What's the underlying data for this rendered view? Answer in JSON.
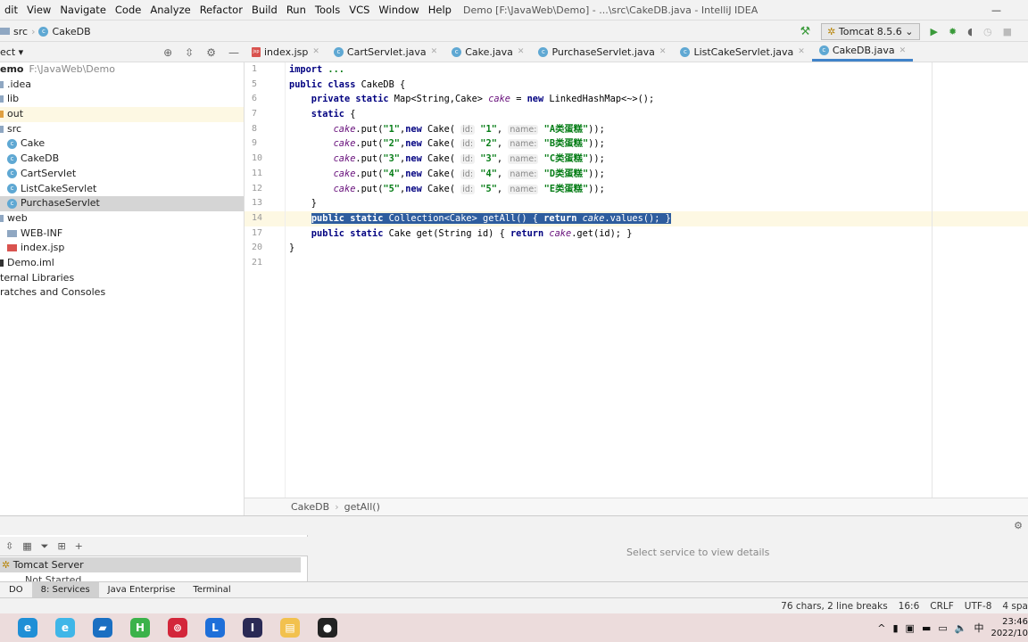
{
  "menu": [
    "dit",
    "View",
    "Navigate",
    "Code",
    "Analyze",
    "Refactor",
    "Build",
    "Run",
    "Tools",
    "VCS",
    "Window",
    "Help"
  ],
  "window_title": "Demo [F:\\JavaWeb\\Demo] - ...\\src\\CakeDB.java - IntelliJ IDEA",
  "breadcrumb": [
    "src",
    "CakeDB"
  ],
  "run_config": "Tomcat 8.5.6",
  "project_header": "ect ▾",
  "tabs": [
    {
      "label": "index.jsp",
      "icon": "jsp-icon"
    },
    {
      "label": "CartServlet.java",
      "icon": "class-icon"
    },
    {
      "label": "Cake.java",
      "icon": "class-icon"
    },
    {
      "label": "PurchaseServlet.java",
      "icon": "class-icon"
    },
    {
      "label": "ListCakeServlet.java",
      "icon": "class-icon"
    },
    {
      "label": "CakeDB.java",
      "icon": "class-icon",
      "active": true
    }
  ],
  "tree": [
    {
      "label": "emo",
      "extra": "F:\\JavaWeb\\Demo",
      "indent": 0,
      "bold": true
    },
    {
      "label": ".idea",
      "indent": 0,
      "icon": "folder-icon"
    },
    {
      "label": "lib",
      "indent": 0,
      "icon": "folder-icon"
    },
    {
      "label": "out",
      "indent": 0,
      "icon": "folder-icon",
      "highlight": true
    },
    {
      "label": "src",
      "indent": 0,
      "icon": "folder-icon"
    },
    {
      "label": "Cake",
      "indent": 1,
      "icon": "class-icon"
    },
    {
      "label": "CakeDB",
      "indent": 1,
      "icon": "class-icon"
    },
    {
      "label": "CartServlet",
      "indent": 1,
      "icon": "class-icon"
    },
    {
      "label": "ListCakeServlet",
      "indent": 1,
      "icon": "class-icon"
    },
    {
      "label": "PurchaseServlet",
      "indent": 1,
      "icon": "class-icon",
      "selected": true
    },
    {
      "label": "web",
      "indent": 0,
      "icon": "folder-icon"
    },
    {
      "label": "WEB-INF",
      "indent": 1,
      "icon": "folder-icon"
    },
    {
      "label": "index.jsp",
      "indent": 1,
      "icon": "jsp-icon"
    },
    {
      "label": "Demo.iml",
      "indent": 0,
      "icon": "file-icon"
    },
    {
      "label": "ternal Libraries",
      "indent": 0
    },
    {
      "label": "ratches and Consoles",
      "indent": 0
    }
  ],
  "line_numbers": [
    "1",
    "5",
    "6",
    "7",
    "8",
    "9",
    "10",
    "11",
    "12",
    "13",
    "14",
    "17",
    "20",
    "21"
  ],
  "code": [
    [
      {
        "t": "import ",
        "c": "kw"
      },
      {
        "t": "...",
        "c": "st"
      }
    ],
    [
      {
        "t": "public class ",
        "c": "kw"
      },
      {
        "t": "CakeDB {",
        "c": "pl"
      }
    ],
    [
      {
        "t": "    private static ",
        "c": "kw"
      },
      {
        "t": "Map<String,Cake> ",
        "c": "pl"
      },
      {
        "t": "cake",
        "c": "fd"
      },
      {
        "t": " = ",
        "c": "pl"
      },
      {
        "t": "new ",
        "c": "kw"
      },
      {
        "t": "LinkedHashMap<~>();",
        "c": "pl"
      }
    ],
    [
      {
        "t": "    static ",
        "c": "kw"
      },
      {
        "t": "{",
        "c": "pl"
      }
    ],
    [
      {
        "t": "        cake",
        "c": "fd"
      },
      {
        "t": ".put(",
        "c": "pl"
      },
      {
        "t": "\"1\"",
        "c": "st"
      },
      {
        "t": ",",
        "c": "pl"
      },
      {
        "t": "new ",
        "c": "kw"
      },
      {
        "t": "Cake( ",
        "c": "pl"
      },
      {
        "t": "id:",
        "c": "ht"
      },
      {
        "t": " \"1\"",
        "c": "st"
      },
      {
        "t": ", ",
        "c": "pl"
      },
      {
        "t": "name:",
        "c": "ht"
      },
      {
        "t": " \"A类蛋糕\"",
        "c": "st"
      },
      {
        "t": "));",
        "c": "pl"
      }
    ],
    [
      {
        "t": "        cake",
        "c": "fd"
      },
      {
        "t": ".put(",
        "c": "pl"
      },
      {
        "t": "\"2\"",
        "c": "st"
      },
      {
        "t": ",",
        "c": "pl"
      },
      {
        "t": "new ",
        "c": "kw"
      },
      {
        "t": "Cake( ",
        "c": "pl"
      },
      {
        "t": "id:",
        "c": "ht"
      },
      {
        "t": " \"2\"",
        "c": "st"
      },
      {
        "t": ", ",
        "c": "pl"
      },
      {
        "t": "name:",
        "c": "ht"
      },
      {
        "t": " \"B类蛋糕\"",
        "c": "st"
      },
      {
        "t": "));",
        "c": "pl"
      }
    ],
    [
      {
        "t": "        cake",
        "c": "fd"
      },
      {
        "t": ".put(",
        "c": "pl"
      },
      {
        "t": "\"3\"",
        "c": "st"
      },
      {
        "t": ",",
        "c": "pl"
      },
      {
        "t": "new ",
        "c": "kw"
      },
      {
        "t": "Cake( ",
        "c": "pl"
      },
      {
        "t": "id:",
        "c": "ht"
      },
      {
        "t": " \"3\"",
        "c": "st"
      },
      {
        "t": ", ",
        "c": "pl"
      },
      {
        "t": "name:",
        "c": "ht"
      },
      {
        "t": " \"C类蛋糕\"",
        "c": "st"
      },
      {
        "t": "));",
        "c": "pl"
      }
    ],
    [
      {
        "t": "        cake",
        "c": "fd"
      },
      {
        "t": ".put(",
        "c": "pl"
      },
      {
        "t": "\"4\"",
        "c": "st"
      },
      {
        "t": ",",
        "c": "pl"
      },
      {
        "t": "new ",
        "c": "kw"
      },
      {
        "t": "Cake( ",
        "c": "pl"
      },
      {
        "t": "id:",
        "c": "ht"
      },
      {
        "t": " \"4\"",
        "c": "st"
      },
      {
        "t": ", ",
        "c": "pl"
      },
      {
        "t": "name:",
        "c": "ht"
      },
      {
        "t": " \"D类蛋糕\"",
        "c": "st"
      },
      {
        "t": "));",
        "c": "pl"
      }
    ],
    [
      {
        "t": "        cake",
        "c": "fd"
      },
      {
        "t": ".put(",
        "c": "pl"
      },
      {
        "t": "\"5\"",
        "c": "st"
      },
      {
        "t": ",",
        "c": "pl"
      },
      {
        "t": "new ",
        "c": "kw"
      },
      {
        "t": "Cake( ",
        "c": "pl"
      },
      {
        "t": "id:",
        "c": "ht"
      },
      {
        "t": " \"5\"",
        "c": "st"
      },
      {
        "t": ", ",
        "c": "pl"
      },
      {
        "t": "name:",
        "c": "ht"
      },
      {
        "t": " \"E类蛋糕\"",
        "c": "st"
      },
      {
        "t": "));",
        "c": "pl"
      }
    ],
    [
      {
        "t": "    }",
        "c": "pl"
      }
    ],
    [
      {
        "t": "    ",
        "c": "pl"
      },
      {
        "sel": [
          {
            "t": "public static ",
            "c": "kw"
          },
          {
            "t": "Collection<Cake> getAll() { ",
            "c": "pl"
          },
          {
            "t": "return ",
            "c": "kw"
          },
          {
            "t": "cake",
            "c": "fd"
          },
          {
            "t": ".values(); }",
            "c": "pl"
          }
        ]
      }
    ],
    [
      {
        "t": "    public static ",
        "c": "kw"
      },
      {
        "t": "Cake get(String id) { ",
        "c": "pl"
      },
      {
        "t": "return ",
        "c": "kw"
      },
      {
        "t": "cake",
        "c": "fd"
      },
      {
        "t": ".get(id); }",
        "c": "pl"
      }
    ],
    [
      {
        "t": "}",
        "c": "pl"
      }
    ],
    []
  ],
  "editor_breadcrumb": [
    "CakeDB",
    "getAll()"
  ],
  "services": {
    "root": "Tomcat Server",
    "child": "Not Started",
    "empty_message": "Select service to view details"
  },
  "tool_tabs": [
    {
      "label": "DO"
    },
    {
      "label": "8: Services",
      "active": true
    },
    {
      "label": "Java Enterprise"
    },
    {
      "label": "Terminal"
    }
  ],
  "status": {
    "selection": "76 chars, 2 line breaks",
    "position": "16:6",
    "line_sep": "CRLF",
    "encoding": "UTF-8",
    "indent": "4 spa"
  },
  "tray": {
    "ime": "中",
    "time": "23:46",
    "date": "2022/10"
  },
  "taskbar_apps": [
    {
      "name": "edge",
      "color": "#1f8fd6",
      "glyph": "e"
    },
    {
      "name": "browser-e",
      "color": "#3fb6e8",
      "glyph": "e"
    },
    {
      "name": "app-green",
      "color": "#1a6fc2",
      "glyph": "▰"
    },
    {
      "name": "hbuilder",
      "color": "#3bb24a",
      "glyph": "H"
    },
    {
      "name": "netease-music",
      "color": "#d3263a",
      "glyph": "⊚"
    },
    {
      "name": "app-l",
      "color": "#1e6fd9",
      "glyph": "L"
    },
    {
      "name": "intellij",
      "color": "#2a2a55",
      "glyph": "I"
    },
    {
      "name": "file-explorer",
      "color": "#f2c14e",
      "glyph": "▤"
    },
    {
      "name": "obs",
      "color": "#222",
      "glyph": "●"
    }
  ]
}
